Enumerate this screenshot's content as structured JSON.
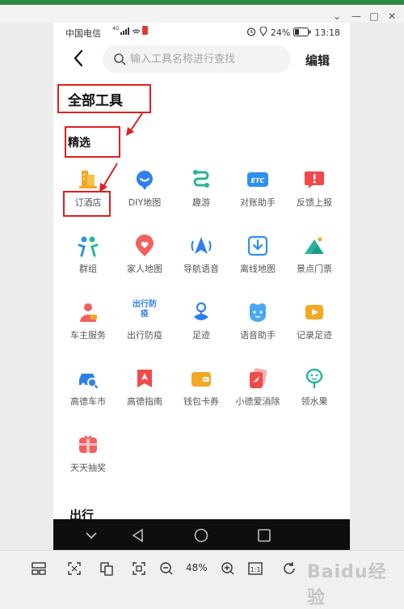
{
  "status_bar": {
    "carrier": "中国电信",
    "signal": "4G",
    "battery": "24%",
    "time": "13:18"
  },
  "header": {
    "search_placeholder": "输入工具名称进行查找",
    "edit_label": "编辑"
  },
  "page_title": "全部工具",
  "sections": [
    {
      "title": "精选",
      "tools": [
        {
          "label": "订酒店",
          "icon": "hotel-icon"
        },
        {
          "label": "DIY地图",
          "icon": "diy-map-icon"
        },
        {
          "label": "趣游",
          "icon": "fun-travel-icon"
        },
        {
          "label": "对账助手",
          "icon": "etc-icon"
        },
        {
          "label": "反馈上报",
          "icon": "feedback-icon"
        },
        {
          "label": "群组",
          "icon": "group-icon"
        },
        {
          "label": "家人地图",
          "icon": "family-map-icon"
        },
        {
          "label": "导航语音",
          "icon": "nav-voice-icon"
        },
        {
          "label": "离线地图",
          "icon": "offline-map-icon"
        },
        {
          "label": "景点门票",
          "icon": "scenic-ticket-icon"
        },
        {
          "label": "车主服务",
          "icon": "car-owner-icon"
        },
        {
          "label": "出行防疫",
          "icon": "travel-epidemic-icon",
          "icon_text": "出行防疫"
        },
        {
          "label": "足迹",
          "icon": "footprint-icon"
        },
        {
          "label": "语音助手",
          "icon": "voice-assistant-icon"
        },
        {
          "label": "记录足迹",
          "icon": "record-footprint-icon"
        },
        {
          "label": "高德车市",
          "icon": "car-market-icon"
        },
        {
          "label": "高德指南",
          "icon": "guide-icon"
        },
        {
          "label": "钱包卡券",
          "icon": "wallet-icon"
        },
        {
          "label": "小德爱消除",
          "icon": "game-icon"
        },
        {
          "label": "领水果",
          "icon": "fruit-icon"
        },
        {
          "label": "天天抽奖",
          "icon": "lottery-icon"
        }
      ]
    },
    {
      "title": "出行"
    }
  ],
  "viewer": {
    "zoom": "48%",
    "watermark": "Baidu经验"
  },
  "colors": {
    "annotation": "#e02020",
    "accent_blue": "#2f7ff0",
    "accent_orange": "#f5a623"
  }
}
